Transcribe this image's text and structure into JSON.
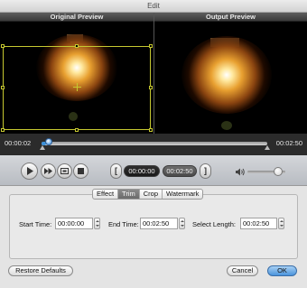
{
  "window": {
    "title": "Edit"
  },
  "preview": {
    "original_label": "Original Preview",
    "output_label": "Output Preview"
  },
  "timeline": {
    "current_time": "00:00:02",
    "total_time": "00:02:50",
    "playhead_fraction": 0.02
  },
  "player": {
    "trim_start": "00:00:00",
    "trim_end": "00:02:50",
    "volume_fraction": 0.8,
    "buttons": [
      "play-icon",
      "fast-forward-icon",
      "snapshot-icon",
      "stop-icon"
    ]
  },
  "tabs": [
    {
      "label": "Effect",
      "active": false
    },
    {
      "label": "Trim",
      "active": true
    },
    {
      "label": "Crop",
      "active": false
    },
    {
      "label": "Watermark",
      "active": false
    }
  ],
  "trim": {
    "start_label": "Start Time:",
    "start_value": "00:00:00",
    "end_label": "End Time:",
    "end_value": "00:02:50",
    "length_label": "Select Length:",
    "length_value": "00:02:50"
  },
  "footer": {
    "restore_label": "Restore Defaults",
    "cancel_label": "Cancel",
    "ok_label": "OK"
  },
  "colors": {
    "accent": "#3a8fd8",
    "crop_frame": "#c6c830"
  }
}
